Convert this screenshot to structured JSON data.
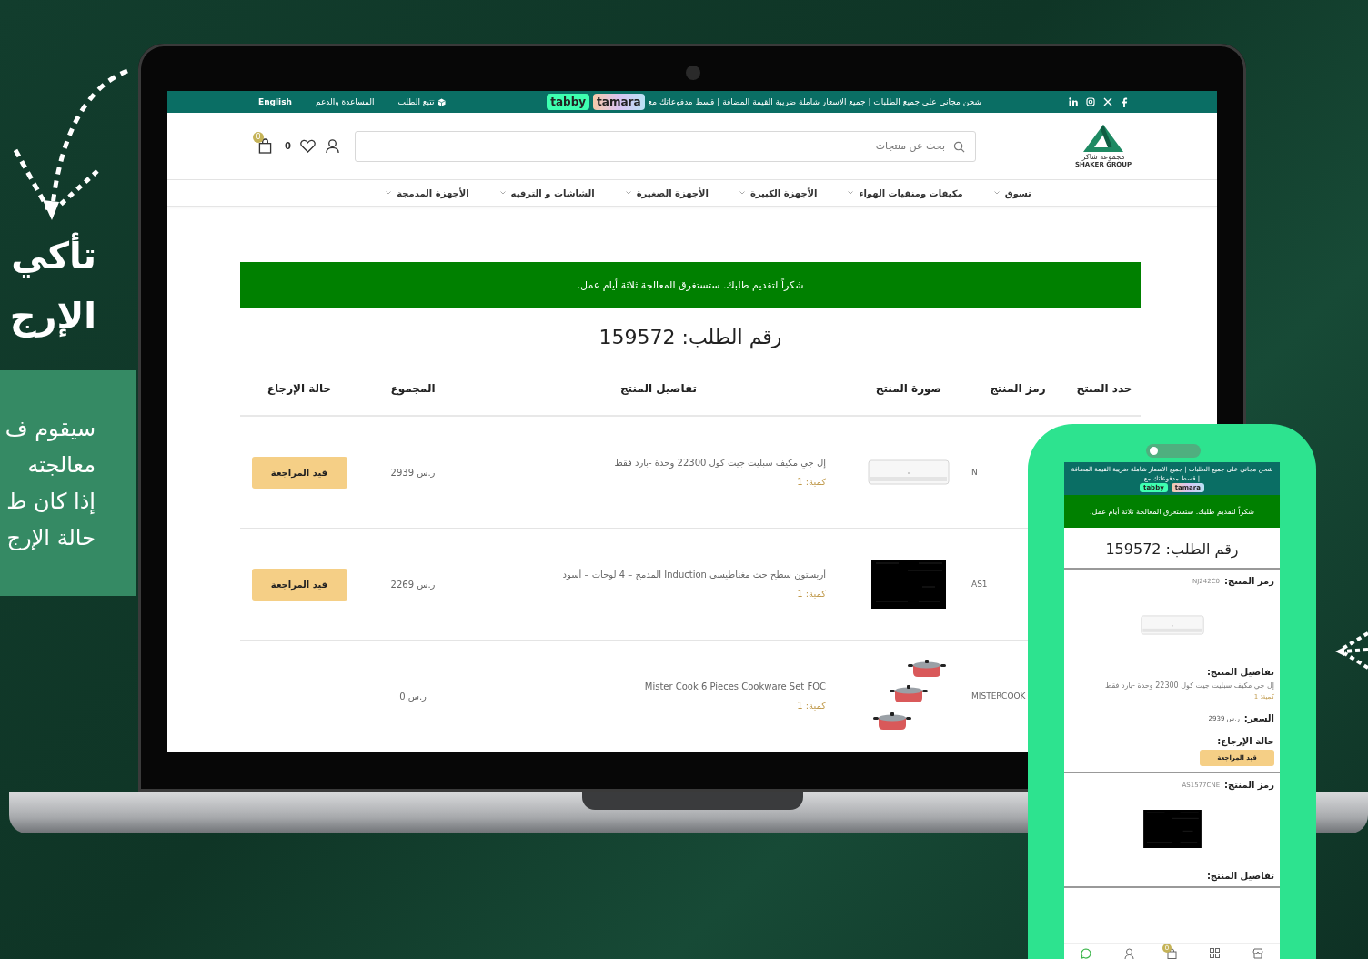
{
  "promo": {
    "headline": [
      "تأكي",
      "الإرج"
    ],
    "body": [
      "سيقوم ف",
      "معالجته",
      "إذا كان ط",
      "حالة الإرج"
    ]
  },
  "laptop": {
    "topbar": {
      "notice": "شحن مجاني على جميع الطلبات | جميع الاسعار شاملة ضريبة القيمة المضافة | قسط مدفوعاتك مع",
      "payment_badges": [
        {
          "kind": "tamara",
          "label": "tamara"
        },
        {
          "kind": "tabby",
          "label": "tabby"
        }
      ],
      "links": [
        {
          "kind": "track",
          "label": "تتبع الطلب"
        },
        {
          "kind": "help",
          "label": "المساعدة والدعم"
        },
        {
          "kind": "language",
          "label": "English"
        }
      ]
    },
    "logo": {
      "name": "مجموعة شاكر",
      "name_en": "SHAKER GROUP"
    },
    "search": {
      "placeholder": "بحث عن منتجات"
    },
    "wishlist_count": "0",
    "cart_count": "0",
    "nav": [
      "تسوق",
      "مكيفات ومنقيات الهواء",
      "الأجهزة الكبيرة",
      "الأجهزة الصغيرة",
      "الشاشات و الترفيه",
      "الأجهزة المدمجة"
    ],
    "banner": "شكراً لتقديم طلبك. ستستغرق المعالجة ثلاثة أيام عمل.",
    "title": "رقم الطلب: 159572",
    "table": {
      "columns": [
        "حدد المنتج",
        "رمز المنتج",
        "صورة المنتج",
        "تفاصيل المنتج",
        "المجموع",
        "حالة الإرجاع"
      ],
      "rows": [
        {
          "code": "N",
          "kind": "air_conditioner",
          "name": "إل جي مكيف سبليت جيت كول 22300 وحدة -بارد فقط",
          "quantity": "كمية: 1",
          "total": "2939 ر.س",
          "status": "قيد المراجعة"
        },
        {
          "code": "AS1",
          "kind": "cooktop",
          "name": "أريستون سطح حث مغناطيسي Induction المدمج – 4 لوحات – أسود",
          "quantity": "كمية: 1",
          "total": "2269 ر.س",
          "status": "قيد المراجعة"
        },
        {
          "code": "MISTERCOOK",
          "kind": "cookware",
          "name": "Mister Cook 6 Pieces Cookware Set FOC",
          "quantity": "كمية: 1",
          "total": "0 ر.س"
        }
      ]
    }
  },
  "phone": {
    "notice": "شحن مجاني على جميع الطلبات | جميع الاسعار شاملة ضريبة القيمة المضافة | قسط مدفوعاتك مع",
    "payment_badges": [
      {
        "kind": "tamara",
        "label": "tamara"
      },
      {
        "kind": "tabby",
        "label": "tabby"
      }
    ],
    "banner": "شكراً لتقديم طلبك. ستستغرق المعالجة ثلاثة أيام عمل.",
    "title": "رقم الطلب: 159572",
    "cart_count": "0",
    "items": [
      {
        "code_label": "رمز المنتج:",
        "code": "NJ242C0",
        "kind": "air_conditioner",
        "details_label": "تفاصيل المنتج:",
        "name": "إل جي مكيف سبليت جيت كول 22300 وحدة -بارد فقط",
        "quantity": "كمية: 1",
        "price_label": "السعر:",
        "price": "2939 ر.س",
        "status_label": "حالة الإرجاع:",
        "status": "قيد المراجعة"
      },
      {
        "code_label": "رمز المنتج:",
        "code": "AS1577CNE",
        "kind": "cooktop",
        "details_label": "تفاصيل المنتج:"
      }
    ]
  }
}
